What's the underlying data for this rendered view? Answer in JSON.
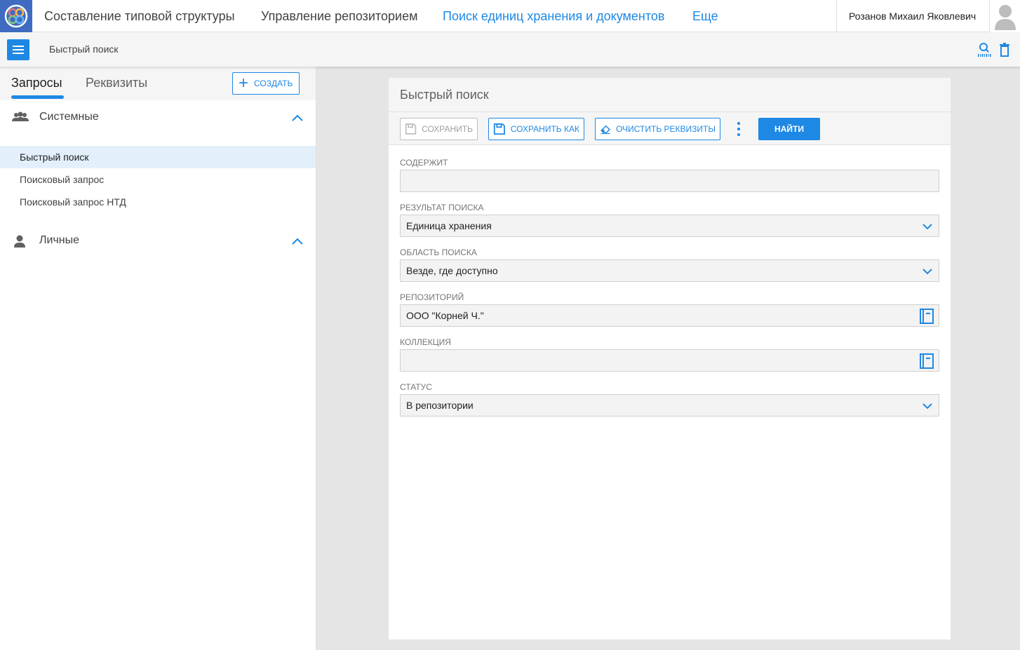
{
  "topnav": {
    "items": [
      {
        "label": "Составление типовой структуры",
        "active": false
      },
      {
        "label": "Управление репозиторием",
        "active": false
      },
      {
        "label": "Поиск единиц хранения и документов",
        "active": true
      },
      {
        "label": "Еще",
        "active": false
      }
    ],
    "user_name": "Розанов Михаил Яковлевич"
  },
  "subbar": {
    "title": "Быстрый поиск",
    "icons": [
      "search-barcode-icon",
      "trash-icon"
    ]
  },
  "sidebar": {
    "tabs": [
      {
        "label": "Запросы",
        "active": true
      },
      {
        "label": "Реквизиты",
        "active": false
      }
    ],
    "create_label": "СОЗДАТЬ",
    "groups": [
      {
        "label": "Системные",
        "icon": "people-icon",
        "expanded": true,
        "items": [
          {
            "label": "Быстрый поиск",
            "selected": true
          },
          {
            "label": "Поисковый запрос",
            "selected": false
          },
          {
            "label": "Поисковый запрос НТД",
            "selected": false
          }
        ]
      },
      {
        "label": "Личные",
        "icon": "person-icon",
        "expanded": true,
        "items": []
      }
    ]
  },
  "form": {
    "title": "Быстрый поиск",
    "toolbar": {
      "save_label": "СОХРАНИТЬ",
      "save_enabled": false,
      "save_as_label": "СОХРАНИТЬ КАК",
      "clear_label": "ОЧИСТИТЬ РЕКВИЗИТЫ",
      "find_label": "НАЙТИ"
    },
    "fields": {
      "contains": {
        "label": "Содержит",
        "value": ""
      },
      "result": {
        "label": "Результат поиска",
        "value": "Единица хранения"
      },
      "scope": {
        "label": "Область поиска",
        "value": "Везде, где доступно"
      },
      "repository": {
        "label": "Репозиторий",
        "value": "ООО \"Корней Ч.\""
      },
      "collection": {
        "label": "Коллекция",
        "value": ""
      },
      "status": {
        "label": "Статус",
        "value": "В репозитории"
      }
    }
  },
  "colors": {
    "accent": "#1e88e5",
    "logo_bg": "#3f6cc0",
    "panel_bg": "#f5f5f5",
    "selected_bg": "#e3f0fc",
    "workspace_bg": "#e5e5e5"
  }
}
